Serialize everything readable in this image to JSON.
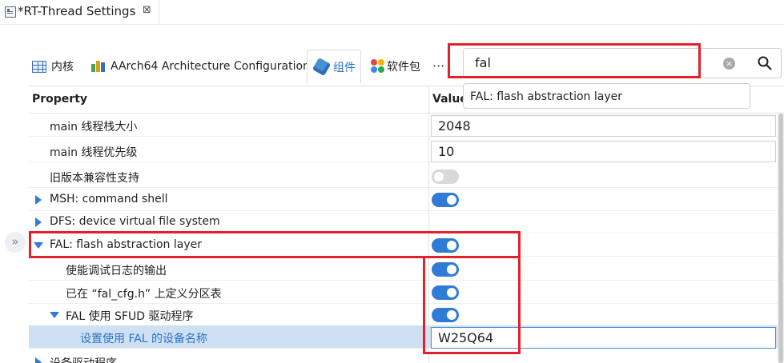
{
  "editor_tab": {
    "title": "*RT-Thread Settings",
    "close": "⊠"
  },
  "tabs": [
    {
      "label": "内核"
    },
    {
      "label": "AArch64 Architecture Configuration"
    },
    {
      "label": "组件"
    },
    {
      "label": "软件包"
    }
  ],
  "more": "···",
  "search": {
    "value": "fal",
    "clear": "×",
    "suggestion": "FAL: flash abstraction layer"
  },
  "table": {
    "col_property": "Property",
    "col_value": "Value",
    "rows": [
      {
        "label": "main 线程栈大小",
        "value": "2048"
      },
      {
        "label": "main 线程优先级",
        "value": "10"
      },
      {
        "label": "旧版本兼容性支持"
      },
      {
        "label": "MSH: command shell"
      },
      {
        "label": "DFS: device virtual file system"
      },
      {
        "label": "FAL: flash abstraction layer"
      },
      {
        "label": "使能调试日志的输出"
      },
      {
        "label": "已在 “fal_cfg.h” 上定义分区表"
      },
      {
        "label": "FAL 使用 SFUD 驱动程序"
      },
      {
        "label": "设置使用 FAL 的设备名称",
        "value": "W25Q64"
      },
      {
        "label": "设备驱动程序"
      }
    ]
  },
  "expand": "»",
  "colors": {
    "accent": "#2f7bd6",
    "highlight": "#e3212b",
    "selected_row": "#cfe0f2"
  }
}
